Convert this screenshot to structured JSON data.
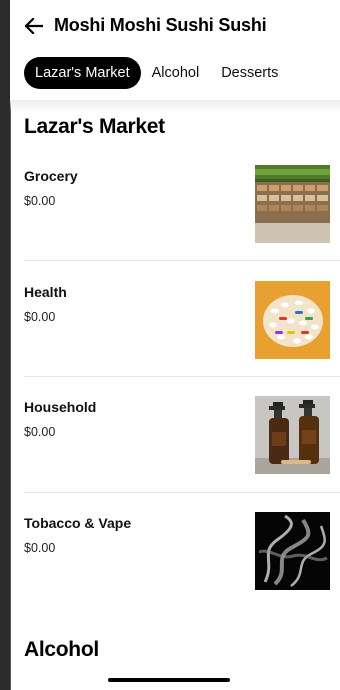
{
  "header": {
    "back_icon": "arrow-left-icon",
    "title": "Moshi Moshi Sushi Sushi"
  },
  "tabs": [
    {
      "label": "Lazar's Market",
      "active": true
    },
    {
      "label": "Alcohol",
      "active": false
    },
    {
      "label": "Desserts",
      "active": false
    }
  ],
  "sections": [
    {
      "title": "Lazar's Market",
      "items": [
        {
          "name": "Grocery",
          "price": "$0.00",
          "image": "grocery-shelves-image"
        },
        {
          "name": "Health",
          "price": "$0.00",
          "image": "pills-image"
        },
        {
          "name": "Household",
          "price": "$0.00",
          "image": "spray-bottles-image"
        },
        {
          "name": "Tobacco & Vape",
          "price": "$0.00",
          "image": "smoke-image"
        }
      ]
    },
    {
      "title": "Alcohol"
    }
  ],
  "colors": {
    "accent": "#000000",
    "background": "#ffffff",
    "divider": "#e8e8e8"
  }
}
